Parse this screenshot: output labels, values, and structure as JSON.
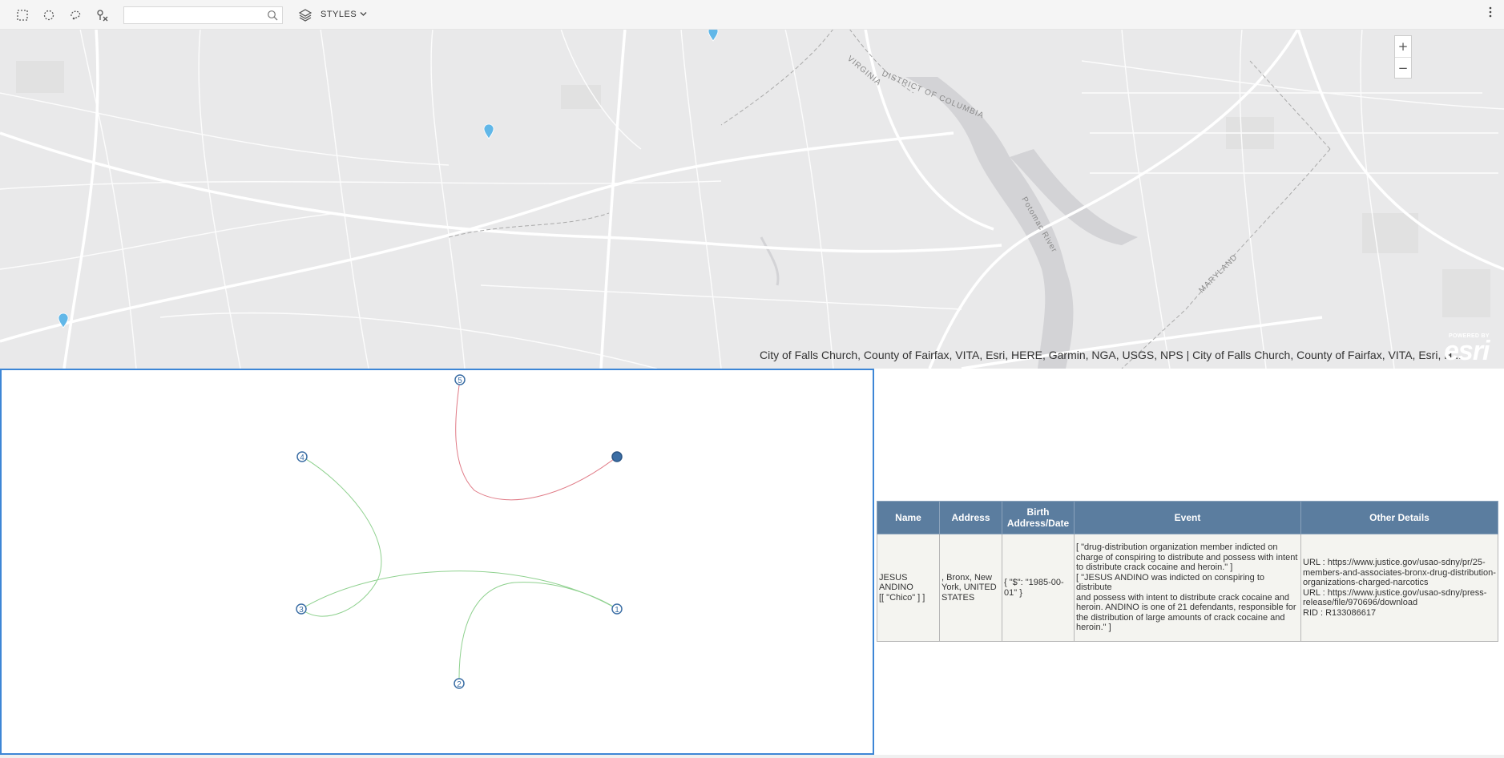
{
  "toolbar": {
    "tools": [
      {
        "name": "rectangle-select-icon"
      },
      {
        "name": "circle-select-icon"
      },
      {
        "name": "lasso-select-icon"
      },
      {
        "name": "clear-selection-icon"
      }
    ],
    "search": {
      "placeholder": "",
      "value": "",
      "icon": "search-icon"
    },
    "layers_icon": "layers-icon",
    "styles_label": "STYLES",
    "styles_icon": "chevron-down-icon",
    "menu_icon": "vertical-ellipsis-icon"
  },
  "map": {
    "zoom_in_label": "+",
    "zoom_out_label": "−",
    "labels": {
      "virginia": "VIRGINIA",
      "dc": "DISTRICT OF COLUMBIA",
      "river": "Potomac River",
      "maryland": "MARYLAND"
    },
    "attribution": "City of Falls Church, County of Fairfax, VITA, Esri, HERE, Garmin, NGA, USGS, NPS | City of Falls Church, County of Fairfax, VITA, Esri, H...",
    "logo": {
      "powered": "POWERED BY",
      "word": "esri"
    },
    "marker_color": "#61b7e8",
    "marker_count": 3
  },
  "graph": {
    "node_color": "#3b6ea5",
    "nodes": [
      {
        "id": "1",
        "label": "1"
      },
      {
        "id": "2",
        "label": "2"
      },
      {
        "id": "3",
        "label": "3"
      },
      {
        "id": "4",
        "label": "4"
      },
      {
        "id": "5",
        "label": "5"
      },
      {
        "id": "hub",
        "label": ""
      }
    ],
    "edges": [
      {
        "from": "5",
        "to": "hub",
        "color": "#e07a86"
      },
      {
        "from": "4",
        "to": "3",
        "color": "#8fd18f"
      },
      {
        "from": "3",
        "to": "1",
        "color": "#8fd18f"
      },
      {
        "from": "2",
        "to": "1",
        "color": "#8fd18f"
      }
    ]
  },
  "table": {
    "header_color": "#5b7d9f",
    "headers": [
      "Name",
      "Address",
      "Birth Address/Date",
      "Event",
      "Other Details"
    ],
    "rows": [
      {
        "name": [
          "JESUS",
          "ANDINO",
          "[[ \"Chico\" ] ]"
        ],
        "address": [
          ", Bronx, New",
          "York, UNITED",
          "STATES"
        ],
        "birth": [
          "{ \"$\": \"1985-00-",
          "01\" }"
        ],
        "event": [
          "[ \"drug-distribution organization member indicted on",
          "charge of conspiring to distribute and possess with intent",
          "to distribute crack cocaine and heroin.\" ]",
          "[ \"JESUS ANDINO was indicted on conspiring to distribute",
          "and possess with intent to distribute crack cocaine and",
          "heroin. ANDINO is one of 21 defendants, responsible for",
          "the distribution of large amounts of crack cocaine and",
          "heroin.\" ]"
        ],
        "other": [
          "URL : https://www.justice.gov/usao-sdny/pr/25-",
          "members-and-associates-bronx-drug-distribution-",
          "organizations-charged-narcotics",
          "URL : https://www.justice.gov/usao-sdny/press-",
          "release/file/970696/download",
          "RID : R133086617"
        ]
      }
    ]
  }
}
